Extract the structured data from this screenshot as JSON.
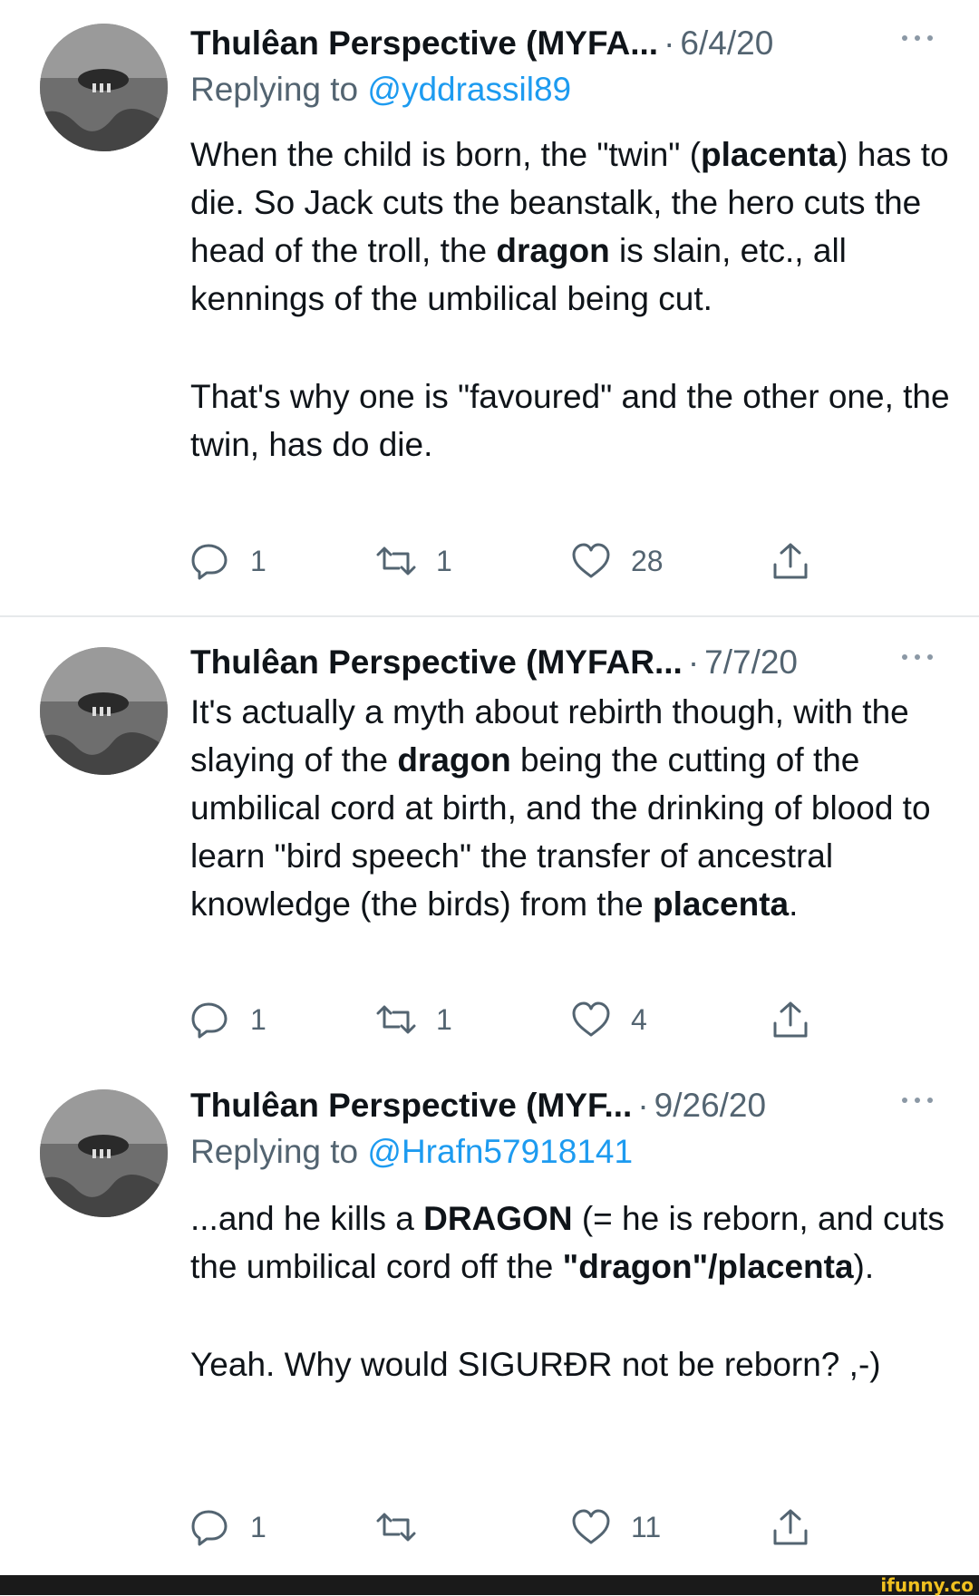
{
  "tweets": [
    {
      "author": "Thulêan Perspective (MYFA...",
      "date": "6/4/20",
      "replying_prefix": "Replying to ",
      "replying_handle": "@yddrassil89",
      "paragraphs": [
        [
          {
            "t": "When the child is born, the \"twin\" ("
          },
          {
            "t": "placenta",
            "b": true
          },
          {
            "t": ") has to die. So Jack cuts the beanstalk, the hero cuts the head of the troll, the "
          },
          {
            "t": "dragon",
            "b": true
          },
          {
            "t": " is slain, etc., all kennings of the umbilical being cut."
          }
        ],
        [
          {
            "t": "That's why one is \"favoured\" and the other one, the twin, has do die."
          }
        ]
      ],
      "counts": {
        "reply": "1",
        "retweet": "1",
        "like": "28"
      }
    },
    {
      "author": "Thulêan Perspective (MYFAR...",
      "date": "7/7/20",
      "paragraphs": [
        [
          {
            "t": "It's actually a myth about rebirth though, with the slaying of the "
          },
          {
            "t": "dragon",
            "b": true
          },
          {
            "t": " being the cutting of the umbilical cord at birth, and the drinking of blood to learn \"bird speech\" the transfer of ancestral knowledge (the birds) from the "
          },
          {
            "t": "placenta",
            "b": true
          },
          {
            "t": "."
          }
        ]
      ],
      "counts": {
        "reply": "1",
        "retweet": "1",
        "like": "4"
      }
    },
    {
      "author": "Thulêan Perspective (MYF...",
      "date": "9/26/20",
      "replying_prefix": "Replying to ",
      "replying_handle": "@Hrafn57918141",
      "paragraphs": [
        [
          {
            "t": "...and he kills a "
          },
          {
            "t": "DRAGON",
            "b": true
          },
          {
            "t": " (= he is reborn, and cuts the umbilical cord off the "
          },
          {
            "t": "\"dragon\"/placenta",
            "b": true
          },
          {
            "t": ")."
          }
        ],
        [
          {
            "t": "Yeah. Why would SIGURÐR not be reborn? ,-)"
          }
        ]
      ],
      "counts": {
        "reply": "1",
        "retweet": "",
        "like": "11"
      }
    }
  ],
  "watermark": "ifunny.co",
  "icons": {
    "reply": "reply-icon",
    "retweet": "retweet-icon",
    "like": "heart-icon",
    "share": "share-icon",
    "more": "more-options-icon"
  },
  "colors": {
    "text": "#0f1419",
    "secondary": "#536471",
    "link": "#1d9bf0",
    "divider": "#e6e9eb"
  }
}
